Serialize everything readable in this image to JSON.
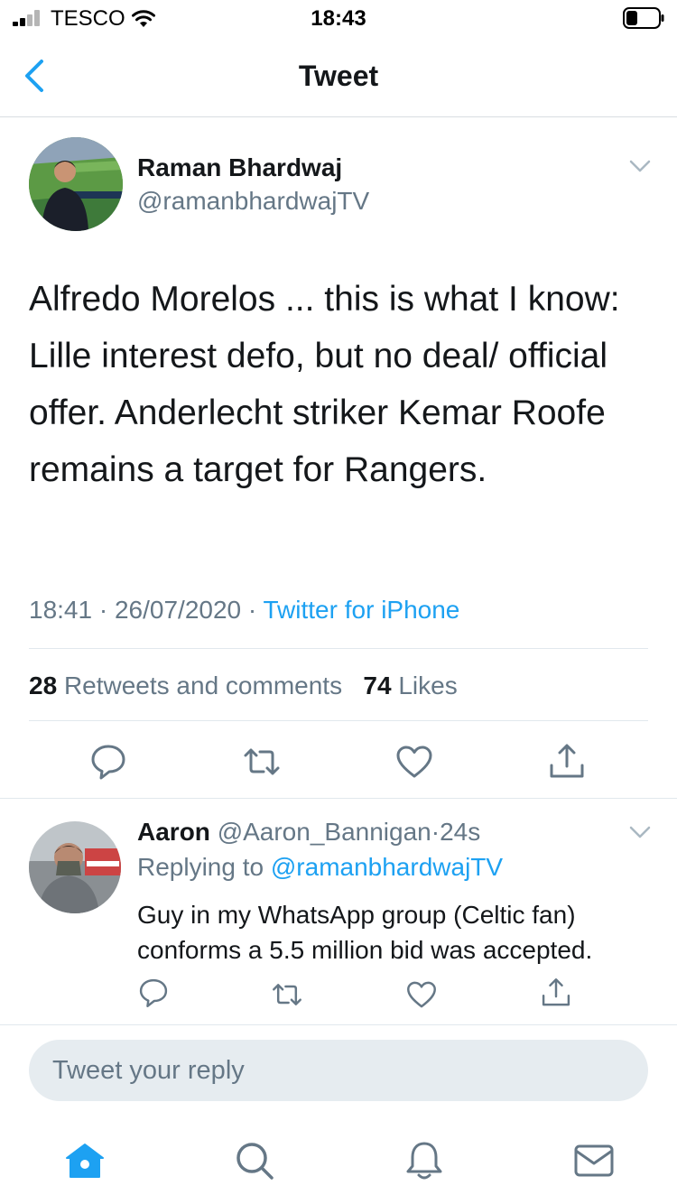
{
  "status_bar": {
    "carrier": "TESCO",
    "time": "18:43"
  },
  "nav": {
    "title": "Tweet"
  },
  "tweet": {
    "author_name": "Raman Bhardwaj",
    "author_handle": "@ramanbhardwajTV",
    "text": "Alfredo Morelos ... this is what I know: Lille interest defo, but no deal/ official offer. Anderlecht striker Kemar Roofe remains a target for Rangers.",
    "time": "18:41",
    "separator": "·",
    "date": "26/07/2020",
    "source": "Twitter for iPhone",
    "retweets_count": "28",
    "retweets_label": "Retweets and comments",
    "likes_count": "74",
    "likes_label": "Likes"
  },
  "reply": {
    "name": "Aaron",
    "handle": "@Aaron_Bannigan",
    "separator": "·",
    "age": "24s",
    "replying_prefix": "Replying to",
    "replying_to": "@ramanbhardwajTV",
    "text": "Guy in my WhatsApp group (Celtic fan) conforms a 5.5 million bid was accepted."
  },
  "composer": {
    "placeholder": "Tweet your reply"
  },
  "icons": {
    "accent": "#1da1f2",
    "muted": "#657786",
    "back": "chevron-left-icon",
    "reply": "reply-icon",
    "retweet": "retweet-icon",
    "like": "heart-icon",
    "share": "share-icon",
    "home": "home-icon",
    "search": "search-icon",
    "notifications": "bell-icon",
    "messages": "mail-icon"
  }
}
